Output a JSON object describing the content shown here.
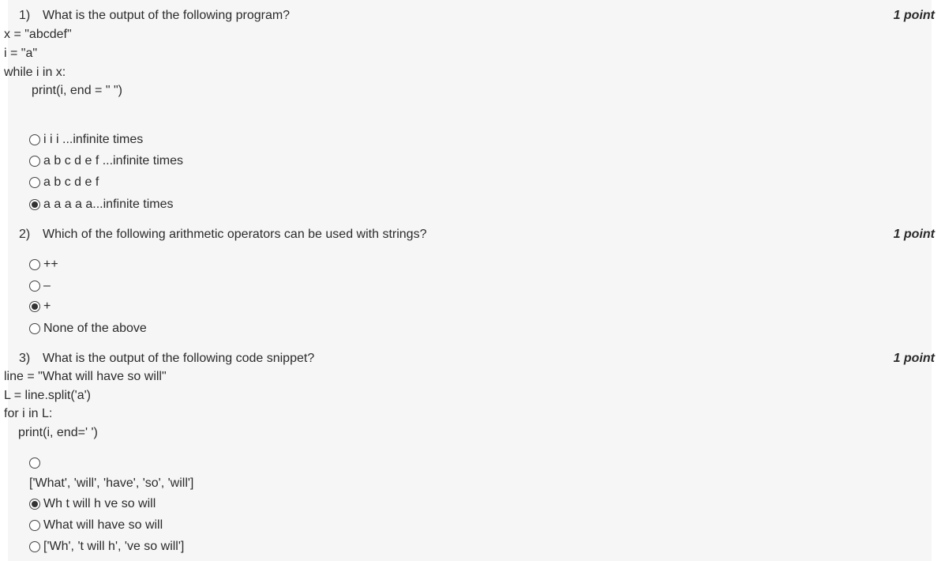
{
  "questions": [
    {
      "number": "1)",
      "text": "What is the output of the following program?",
      "points": "1 point",
      "code": [
        "x = \"abcdef\"",
        "i = \"a\"",
        "while i in x:",
        "print(i, end = \" \")"
      ],
      "options": [
        {
          "label": "i i i ...infinite times",
          "selected": false
        },
        {
          "label": "a b c d e f ...infinite times",
          "selected": false
        },
        {
          "label": "a b c d e f",
          "selected": false
        },
        {
          "label": "a a a a a...infinite times",
          "selected": true
        }
      ]
    },
    {
      "number": "2)",
      "text": "Which of the following arithmetic operators can be used with strings?",
      "points": "1 point",
      "code": [],
      "options": [
        {
          "label": "++",
          "selected": false
        },
        {
          "label": "–",
          "selected": false
        },
        {
          "label": "+",
          "selected": true
        },
        {
          "label": "None of the above",
          "selected": false
        }
      ]
    },
    {
      "number": "3)",
      "text": "What is the output of the following code snippet?",
      "points": "1 point",
      "code": [
        "line = \"What will have so will\"",
        "L = line.split('a')",
        "for i in L:",
        "print(i, end=' ')"
      ],
      "options": [
        {
          "label": "['What', 'will', 'have', 'so', 'will']",
          "selected": false
        },
        {
          "label": "Wh t will h ve so will",
          "selected": true
        },
        {
          "label": "What will have so will",
          "selected": false
        },
        {
          "label": "['Wh', 't will h', 've so will']",
          "selected": false
        }
      ]
    }
  ]
}
